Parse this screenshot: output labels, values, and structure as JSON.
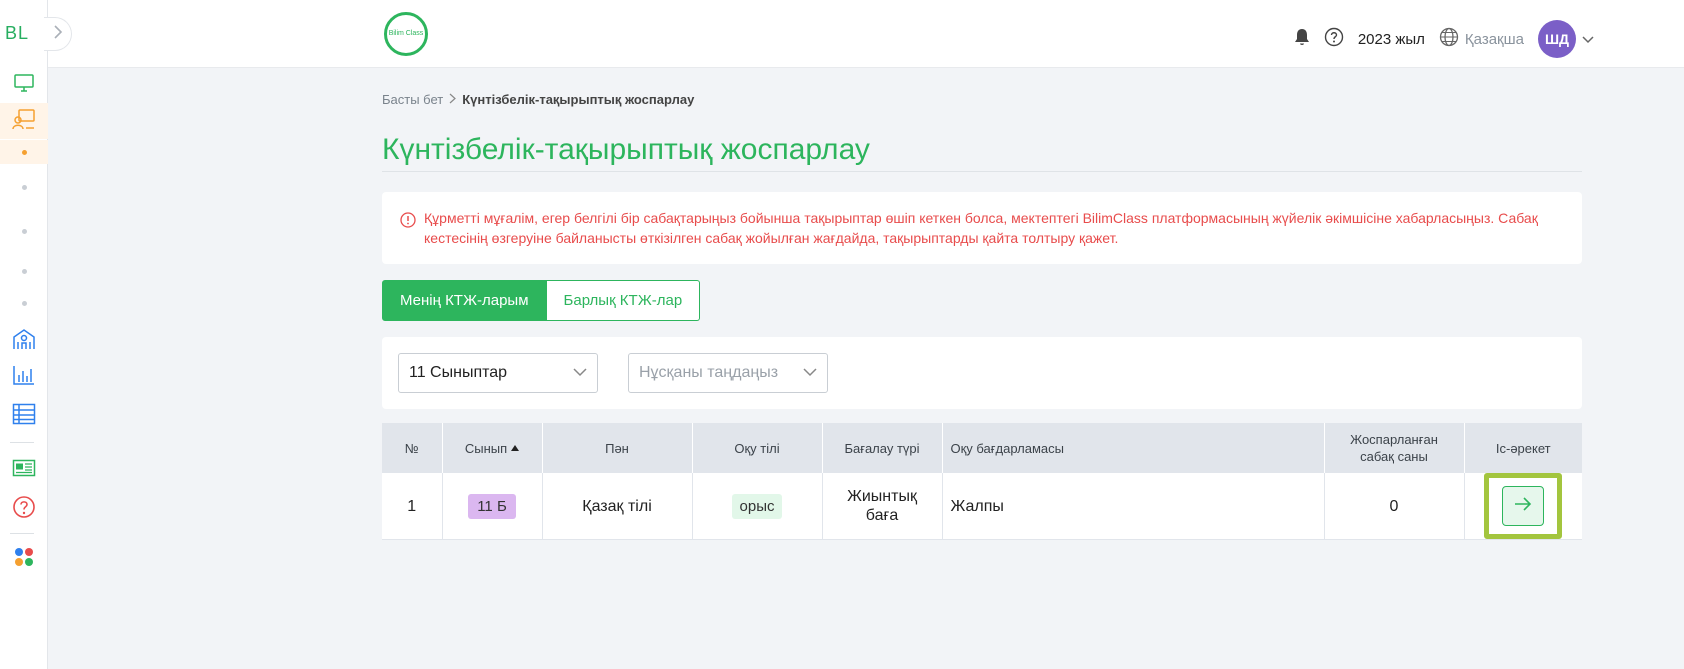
{
  "sidebar": {
    "brand": "BL",
    "icons": [
      "monitor-icon",
      "teacher-board-icon",
      "school-icon",
      "chart-bars-icon",
      "table-grid-icon",
      "news-icon",
      "help-circle-icon",
      "apps-dots-icon"
    ]
  },
  "header": {
    "logo_text": "Bilim Class",
    "year": "2023 жыл",
    "language": "Қазақша",
    "avatar_initials": "ШД"
  },
  "breadcrumb": {
    "home": "Басты бет",
    "current": "Күнтізбелік-тақырыптық жоспарлау"
  },
  "page_title": "Күнтізбелік-тақырыптық жоспарлау",
  "alert": {
    "text": "Құрметті мұғалім, егер белгілі бір сабақтарыңыз бойынша тақырыптар өшіп кеткен болса, мектептегі BilimClass платформасының жүйелік әкімшісіне хабарласыңыз. Сабақ кестесінің өзгеруіне байланысты өткізілген сабақ жойылған жағдайда, тақырыптарды қайта толтыру қажет."
  },
  "tabs": {
    "my": "Менің КТЖ-ларым",
    "all": "Барлық КТЖ-лар"
  },
  "filters": {
    "class_value": "11 Сыныптар",
    "variant_placeholder": "Нұсқаны таңдаңыз"
  },
  "table": {
    "headers": {
      "num": "№",
      "class": "Сынып",
      "subject": "Пән",
      "language": "Оқу тілі",
      "assessment": "Бағалау түрі",
      "program": "Оқу бағдарламасы",
      "planned": "Жоспарланған сабақ саны",
      "action": "Іс-әрекет"
    },
    "rows": [
      {
        "num": "1",
        "class": "11 Б",
        "subject": "Қазақ тілі",
        "language": "орыс",
        "assessment": "Жиынтық баға",
        "program": "Жалпы",
        "planned": "0"
      }
    ]
  },
  "colors": {
    "accent": "#2db55d",
    "alert": "#e84c4c",
    "highlight": "#a3c53e",
    "avatar": "#7b5fc7"
  }
}
